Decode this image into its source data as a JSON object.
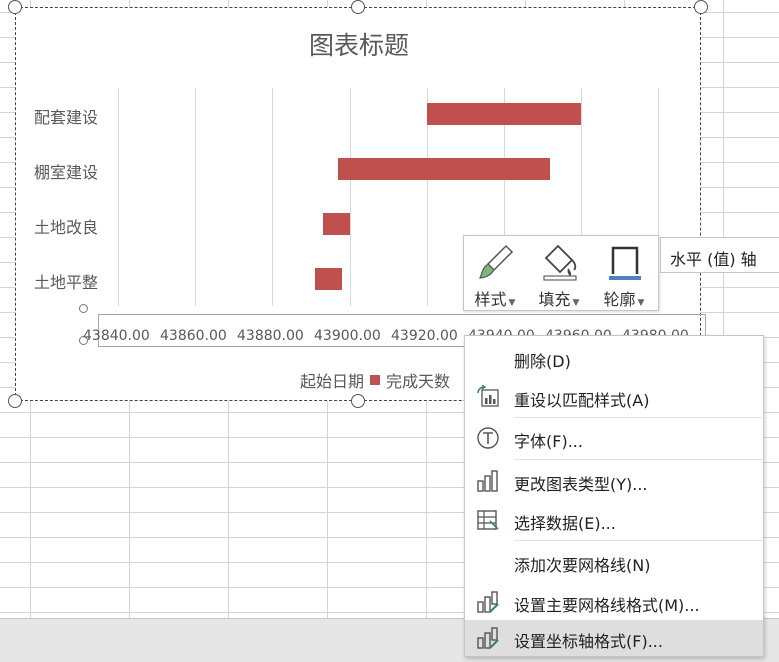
{
  "chart": {
    "title": "图表标题",
    "categories": [
      "配套建设",
      "棚室建设",
      "土地改良",
      "土地平整"
    ],
    "x_ticks": [
      "43840.00",
      "43860.00",
      "43880.00",
      "43900.00",
      "43920.00",
      "43940.00",
      "43960.00",
      "43980.00"
    ],
    "legend": {
      "start": "起始日期",
      "duration": "完成天数"
    },
    "bar_color": "#c0504d"
  },
  "chart_data": {
    "type": "bar",
    "orientation": "horizontal",
    "stacked": true,
    "title": "图表标题",
    "categories": [
      "配套建设",
      "棚室建设",
      "土地改良",
      "土地平整"
    ],
    "series": [
      {
        "name": "起始日期",
        "visible": false,
        "values": [
          43920,
          43897,
          43893,
          43891
        ]
      },
      {
        "name": "完成天数",
        "color": "#c0504d",
        "values": [
          40,
          55,
          7,
          7
        ]
      }
    ],
    "xlim": [
      43840,
      43990
    ],
    "grid": true,
    "legend_position": "bottom"
  },
  "toolbar": {
    "style_label": "样式",
    "fill_label": "填充",
    "outline_label": "轮廓",
    "axis_select": "水平 (值) 轴"
  },
  "menu": {
    "items": [
      {
        "label": "删除(D)",
        "icon": "none"
      },
      {
        "label": "重设以匹配样式(A)",
        "icon": "reset-style-icon"
      },
      {
        "label": "字体(F)...",
        "icon": "font-icon"
      },
      {
        "label": "更改图表类型(Y)...",
        "icon": "chart-type-icon"
      },
      {
        "label": "选择数据(E)...",
        "icon": "select-data-icon"
      },
      {
        "label": "添加次要网格线(N)",
        "icon": "none"
      },
      {
        "label": "设置主要网格线格式(M)...",
        "icon": "format-gridlines-icon"
      },
      {
        "label": "设置坐标轴格式(F)...",
        "icon": "format-axis-icon"
      }
    ]
  }
}
